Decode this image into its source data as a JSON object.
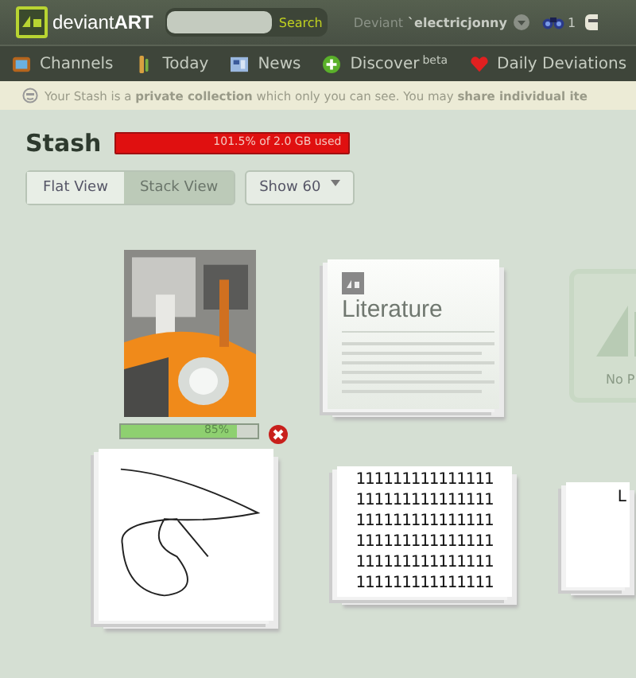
{
  "header": {
    "logo": "deviant**ART**",
    "search_button": "Search",
    "user_prefix": "Deviant",
    "username": "`electricjonny",
    "notification_count": "1"
  },
  "nav": [
    {
      "kind": "tv",
      "label": "Channels"
    },
    {
      "kind": "today",
      "label": "Today"
    },
    {
      "kind": "news",
      "label": "News"
    },
    {
      "kind": "discover",
      "label": "Discover",
      "badge": "beta"
    },
    {
      "kind": "heart",
      "label": "Daily Deviations"
    }
  ],
  "notice": "Your Stash is a **private collection** which only you can see. You may **share individual ite**",
  "stash": {
    "title": "Stash",
    "storage": {
      "label": "101.5% of 2.0 GB used",
      "level": 1
    }
  },
  "view_toggle": [
    {
      "label": "Flat View",
      "selected": false
    },
    {
      "label": "Stack View",
      "selected": true
    }
  ],
  "show_select": "Show 60",
  "items": [
    {
      "upload": {
        "level": 0.85,
        "reading": "85%"
      }
    },
    {
      "kind": "literature",
      "title": "Literature"
    },
    {
      "kind": "placeholder",
      "caption": "No P"
    },
    {
      "kind": "sketch"
    },
    {
      "kind": "text",
      "lines": [
        "111111111111111",
        "111111111111111",
        "111111111111111",
        "111111111111111",
        "111111111111111",
        "111111111111111"
      ]
    },
    {
      "kind": "text-partial",
      "lines": [
        "L"
      ]
    }
  ]
}
